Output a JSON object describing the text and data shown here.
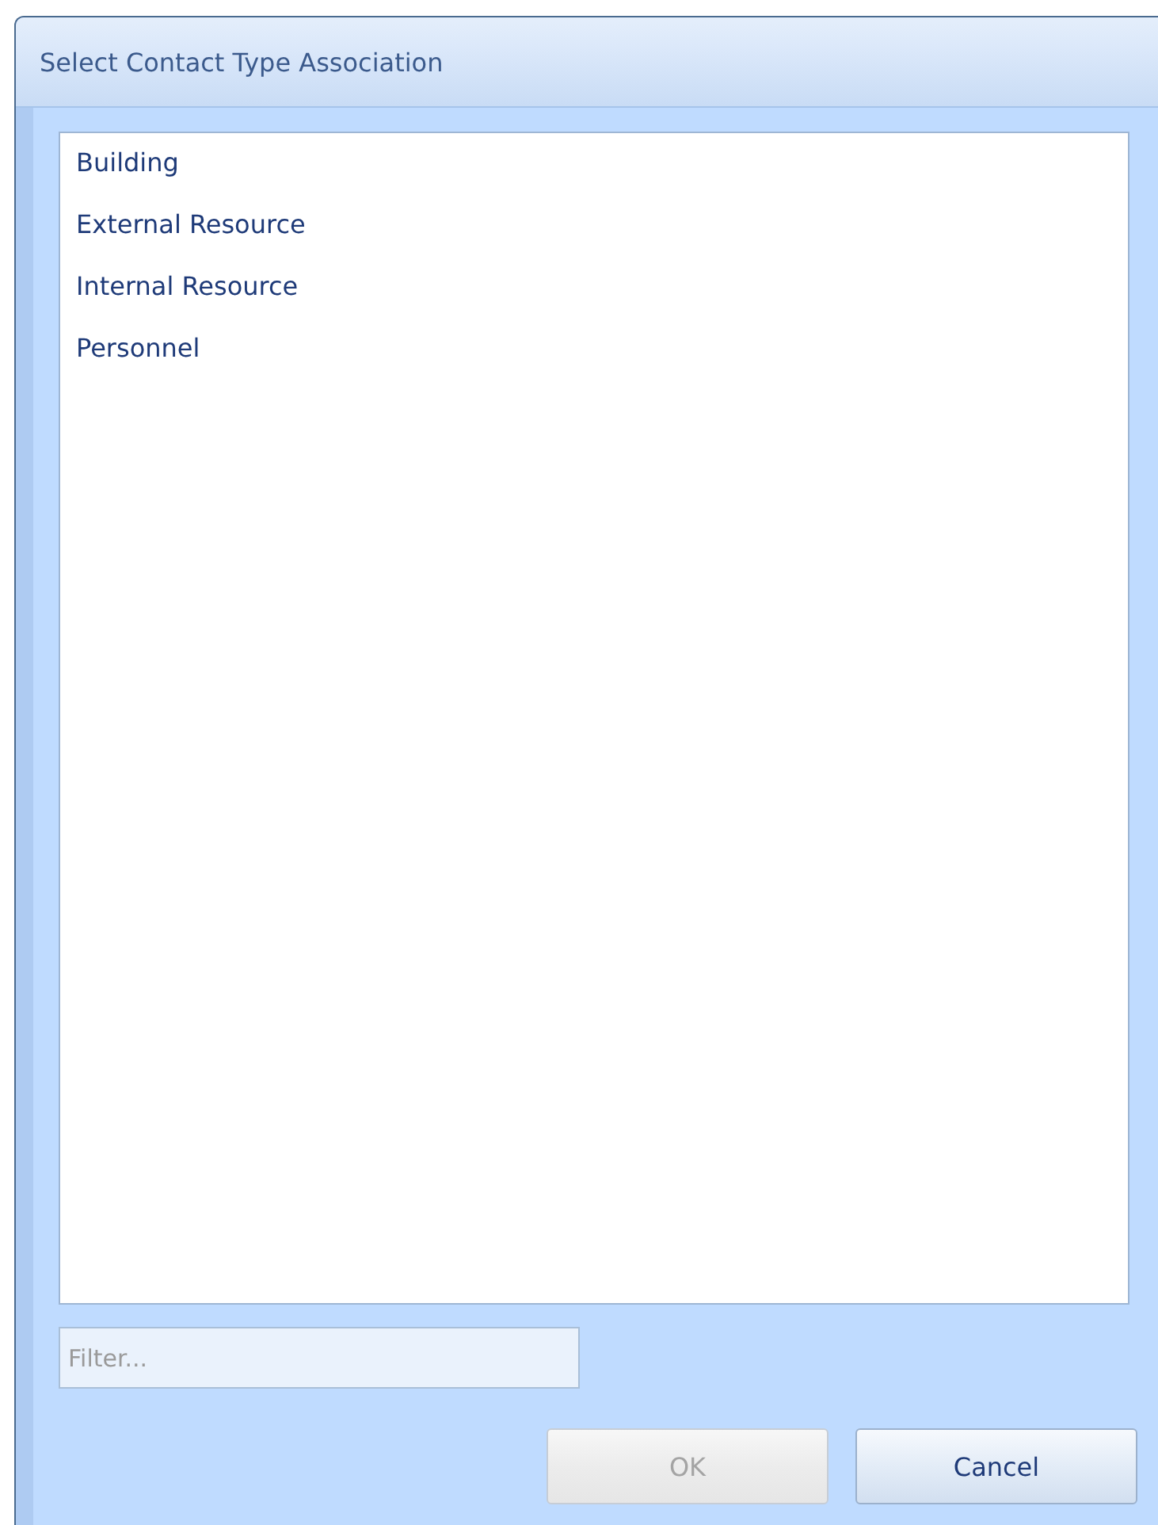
{
  "window": {
    "title": "Select Contact Type Association"
  },
  "items": [
    {
      "label": "Building",
      "selected": false
    },
    {
      "label": "External Resource",
      "selected": false
    },
    {
      "label": "Internal Resource",
      "selected": false
    },
    {
      "label": "Personnel",
      "selected": false
    }
  ],
  "filter": {
    "placeholder": "Filter..."
  },
  "buttons": [
    {
      "label": "OK",
      "disabled": true
    },
    {
      "label": "Cancel",
      "disabled": false
    }
  ]
}
